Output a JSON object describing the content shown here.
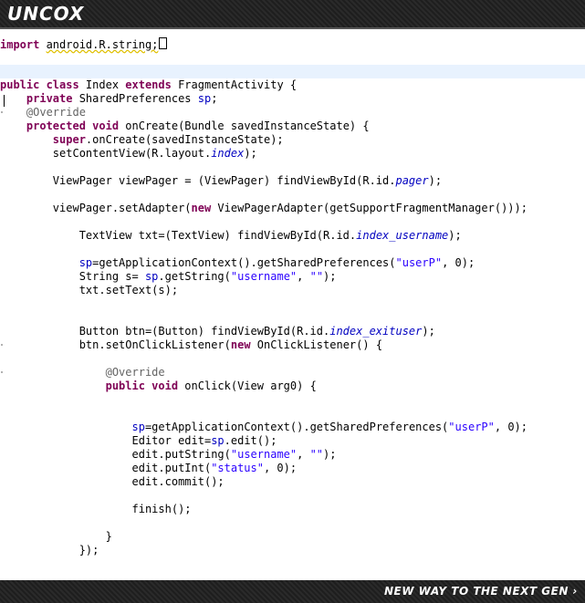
{
  "header": {
    "logo": "UNCOX"
  },
  "footer": {
    "slogan": "NEW WAY TO THE NEXT GEN ›"
  },
  "code": {
    "l_import": [
      "import ",
      "android.R.string;"
    ],
    "l_class": [
      "public class ",
      "Index ",
      "extends ",
      "FragmentActivity {"
    ],
    "l_field": [
      "    private ",
      "SharedPreferences ",
      "sp",
      ";"
    ],
    "l_override1": "    @Override",
    "l_oncreate": [
      "    protected void ",
      "onCreate(Bundle savedInstanceState) {"
    ],
    "l_super": [
      "        super",
      ".onCreate(savedInstanceState);"
    ],
    "l_setcontent": [
      "        setContentView(R.layout.",
      "index",
      ");"
    ],
    "l_viewpager": "        ViewPager viewPager = (ViewPager) findViewById(R.id.",
    "l_viewpager_id": "pager",
    "l_viewpager_end": ");",
    "l_adapter": [
      "        viewPager.setAdapter(",
      "new ",
      "ViewPagerAdapter(getSupportFragmentManager()));"
    ],
    "l_textview": [
      "            TextView txt=(TextView) findViewById(R.id.",
      "index_username",
      ");"
    ],
    "l_sp1": [
      "            ",
      "sp",
      "=getApplicationContext().getSharedPreferences(",
      "\"userP\"",
      ", 0);"
    ],
    "l_string": [
      "            String s= ",
      "sp",
      ".getString(",
      "\"username\"",
      ", ",
      "\"\"",
      ");"
    ],
    "l_settext": "            txt.setText(s);",
    "l_button": [
      "            Button btn=(Button) findViewById(R.id.",
      "index_exituser",
      ");"
    ],
    "l_listener": [
      "            btn.setOnClickListener(",
      "new ",
      "OnClickListener() {"
    ],
    "l_override2": "                @Override",
    "l_onclick": [
      "                public void ",
      "onClick(View arg0) {"
    ],
    "l_sp2": [
      "                    ",
      "sp",
      "=getApplicationContext().getSharedPreferences(",
      "\"userP\"",
      ", 0);"
    ],
    "l_editor": [
      "                    Editor edit=",
      "sp",
      ".edit();"
    ],
    "l_putstring": [
      "                    edit.putString(",
      "\"username\"",
      ", ",
      "\"\"",
      ");"
    ],
    "l_putint": [
      "                    edit.putInt(",
      "\"status\"",
      ", 0);"
    ],
    "l_commit": "                    edit.commit();",
    "l_finish": "                    finish();",
    "l_closebrace": "                }",
    "l_close": "            });"
  }
}
